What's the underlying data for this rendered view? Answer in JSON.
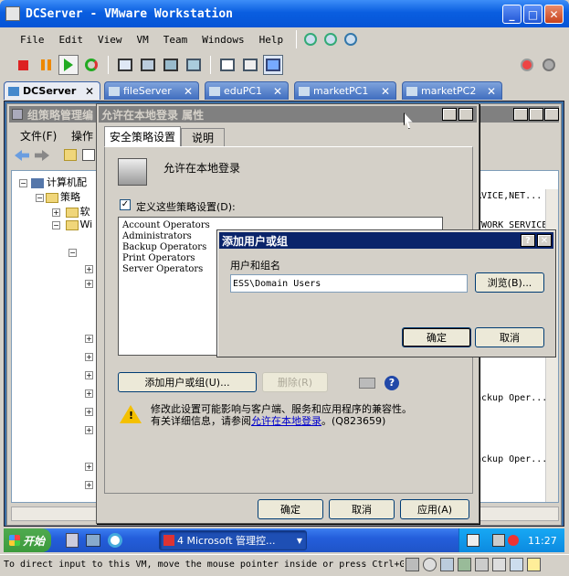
{
  "window": {
    "title": "DCServer - VMware Workstation"
  },
  "menubar": [
    "File",
    "Edit",
    "View",
    "VM",
    "Team",
    "Windows",
    "Help"
  ],
  "tabs": [
    {
      "label": "DCServer",
      "active": true
    },
    {
      "label": "fileServer"
    },
    {
      "label": "eduPC1"
    },
    {
      "label": "marketPC1"
    },
    {
      "label": "marketPC2"
    }
  ],
  "gp_window": {
    "title": "组策略管理编",
    "menu": [
      "文件(F)",
      "操作"
    ],
    "tree": [
      {
        "label": "计算机配"
      },
      {
        "label": "策略"
      },
      {
        "label": "软"
      },
      {
        "label": "Wi"
      }
    ],
    "right_values": [
      "RVICE,NET...",
      "TWORK SERVICE",
      "ackup Oper...",
      "ackup Oper..."
    ]
  },
  "prop_dialog": {
    "title": "允许在本地登录 属性",
    "tabs": [
      "安全策略设置",
      "说明"
    ],
    "policy_name": "允许在本地登录",
    "define_label": "定义这些策略设置(D):",
    "define_checked": true,
    "members": [
      "Account Operators",
      "Administrators",
      "Backup Operators",
      "Print Operators",
      "Server Operators"
    ],
    "add_button": "添加用户或组(U)...",
    "remove_button": "删除(R)",
    "warning_line1": "修改此设置可能影响与客户端、服务和应用程序的兼容性。",
    "warning_line2_pre": "有关详细信息，请参阅",
    "warning_link": "允许在本地登录",
    "warning_code": "。(Q823659)",
    "ok": "确定",
    "cancel": "取消",
    "apply": "应用(A)"
  },
  "add_dialog": {
    "title": "添加用户或组",
    "field_label": "用户和组名",
    "field_value": "ESS\\Domain Users",
    "browse": "浏览(B)...",
    "ok": "确定",
    "cancel": "取消"
  },
  "taskbar": {
    "start": "开始",
    "task": "4 Microsoft 管理控...",
    "clock": "11:27"
  },
  "statusbar": {
    "text": "To direct input to this VM, move the mouse pointer inside or press Ctrl+G."
  },
  "colors": {
    "xp_blue": "#0a5ee0",
    "classic_title": "#0a246a",
    "taskbar": "#245edb",
    "start": "#3c9a3c"
  }
}
